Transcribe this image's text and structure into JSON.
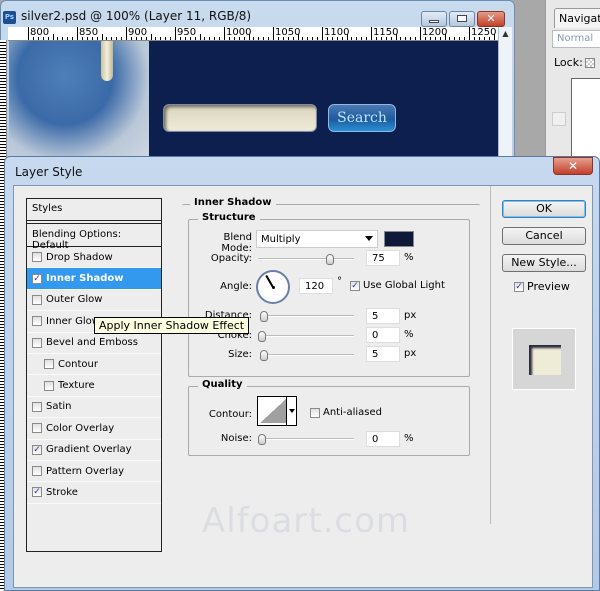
{
  "document_window": {
    "title": "silver2.psd @ 100% (Layer 11, RGB/8)",
    "app_icon": "Ps",
    "ruler_ticks": [
      "800",
      "850",
      "900",
      "950",
      "1000",
      "1050",
      "1100",
      "1150",
      "1200",
      "1250"
    ],
    "controls": {
      "minimize": "minimize-icon",
      "maximize": "maximize-icon",
      "close": "✕"
    },
    "canvas": {
      "search_button_label": "Search",
      "search_field_value": ""
    }
  },
  "side_panel": {
    "tab_label": "Navigato",
    "blend_mode": "Normal",
    "lock_label": "Lock:"
  },
  "dialog": {
    "title": "Layer Style",
    "close_label": "✕",
    "styles_header": "Styles",
    "blending_options": "Blending Options: Default",
    "effects": [
      {
        "label": "Drop Shadow",
        "checked": false,
        "sub": false
      },
      {
        "label": "Inner Shadow",
        "checked": true,
        "sub": false,
        "selected": true
      },
      {
        "label": "Outer Glow",
        "checked": false,
        "sub": false
      },
      {
        "label": "Inner Glow",
        "checked": false,
        "sub": false
      },
      {
        "label": "Bevel and Emboss",
        "checked": false,
        "sub": false
      },
      {
        "label": "Contour",
        "checked": false,
        "sub": true
      },
      {
        "label": "Texture",
        "checked": false,
        "sub": true
      },
      {
        "label": "Satin",
        "checked": false,
        "sub": false
      },
      {
        "label": "Color Overlay",
        "checked": false,
        "sub": false
      },
      {
        "label": "Gradient Overlay",
        "checked": true,
        "sub": false
      },
      {
        "label": "Pattern Overlay",
        "checked": false,
        "sub": false
      },
      {
        "label": "Stroke",
        "checked": true,
        "sub": false
      }
    ],
    "tooltip": "Apply Inner Shadow Effect",
    "panel": {
      "title": "Inner Shadow",
      "structure": {
        "label": "Structure",
        "blend_mode_label": "Blend Mode:",
        "blend_mode_value": "Multiply",
        "shadow_color": "#0e1838",
        "opacity_label": "Opacity:",
        "opacity_value": "75",
        "opacity_unit": "%",
        "opacity_fraction": 0.75,
        "angle_label": "Angle:",
        "angle_value": "120",
        "angle_unit": "°",
        "angle_degrees": 120,
        "use_global_light_label": "Use Global Light",
        "use_global_light": true,
        "distance_label": "Distance:",
        "distance_value": "5",
        "distance_unit": "px",
        "distance_fraction": 0.02,
        "choke_label": "Choke:",
        "choke_value": "0",
        "choke_unit": "%",
        "choke_fraction": 0.0,
        "size_label": "Size:",
        "size_value": "5",
        "size_unit": "px",
        "size_fraction": 0.02
      },
      "quality": {
        "label": "Quality",
        "contour_label": "Contour:",
        "anti_aliased_label": "Anti-aliased",
        "anti_aliased": false,
        "noise_label": "Noise:",
        "noise_value": "0",
        "noise_unit": "%",
        "noise_fraction": 0.0
      }
    },
    "buttons": {
      "ok": "OK",
      "cancel": "Cancel",
      "new_style": "New Style..."
    },
    "preview_label": "Preview",
    "preview_checked": true,
    "watermark": "Alfoart.com"
  }
}
